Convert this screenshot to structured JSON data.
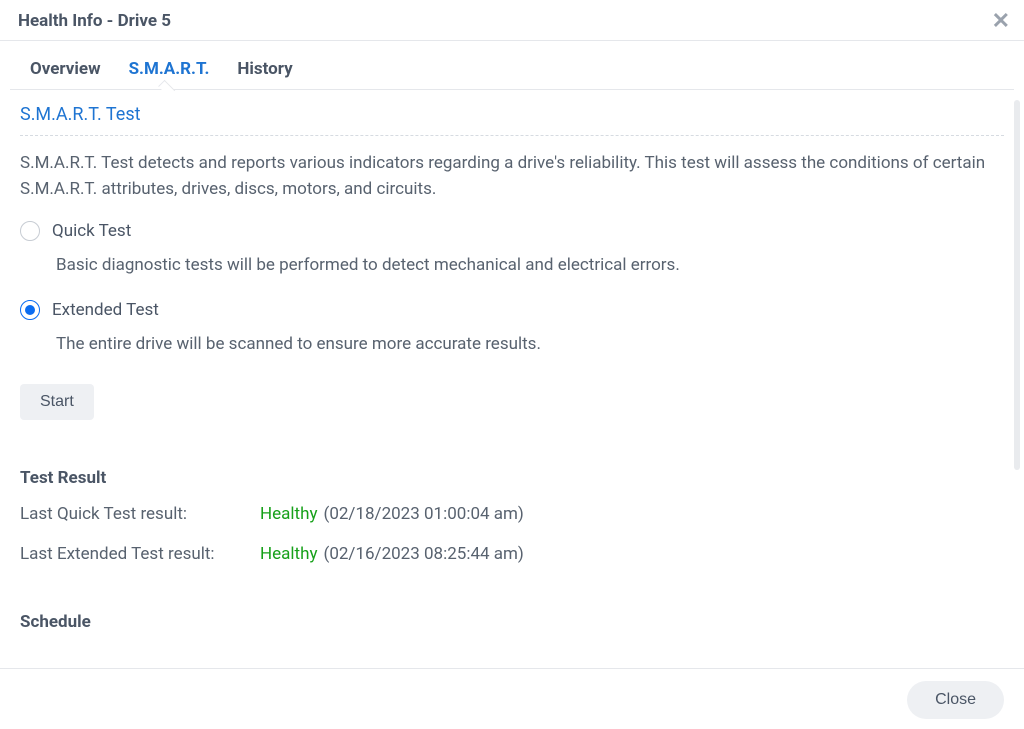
{
  "header": {
    "title": "Health Info - Drive 5"
  },
  "tabs": [
    {
      "label": "Overview"
    },
    {
      "label": "S.M.A.R.T."
    },
    {
      "label": "History"
    }
  ],
  "smart": {
    "section_title": "S.M.A.R.T. Test",
    "description": "S.M.A.R.T. Test detects and reports various indicators regarding a drive's reliability. This test will assess the conditions of certain S.M.A.R.T. attributes, drives, discs, motors, and circuits.",
    "quick": {
      "label": "Quick Test",
      "desc": "Basic diagnostic tests will be performed to detect mechanical and electrical errors."
    },
    "extended": {
      "label": "Extended Test",
      "desc": "The entire drive will be scanned to ensure more accurate results."
    },
    "start_label": "Start"
  },
  "results": {
    "heading": "Test Result",
    "quick_label": "Last Quick Test result:",
    "quick_status": "Healthy",
    "quick_ts": "(02/18/2023 01:00:04 am)",
    "ext_label": "Last Extended Test result:",
    "ext_status": "Healthy",
    "ext_ts": "(02/16/2023 08:25:44 am)"
  },
  "schedule": {
    "heading": "Schedule"
  },
  "footer": {
    "close_label": "Close"
  }
}
